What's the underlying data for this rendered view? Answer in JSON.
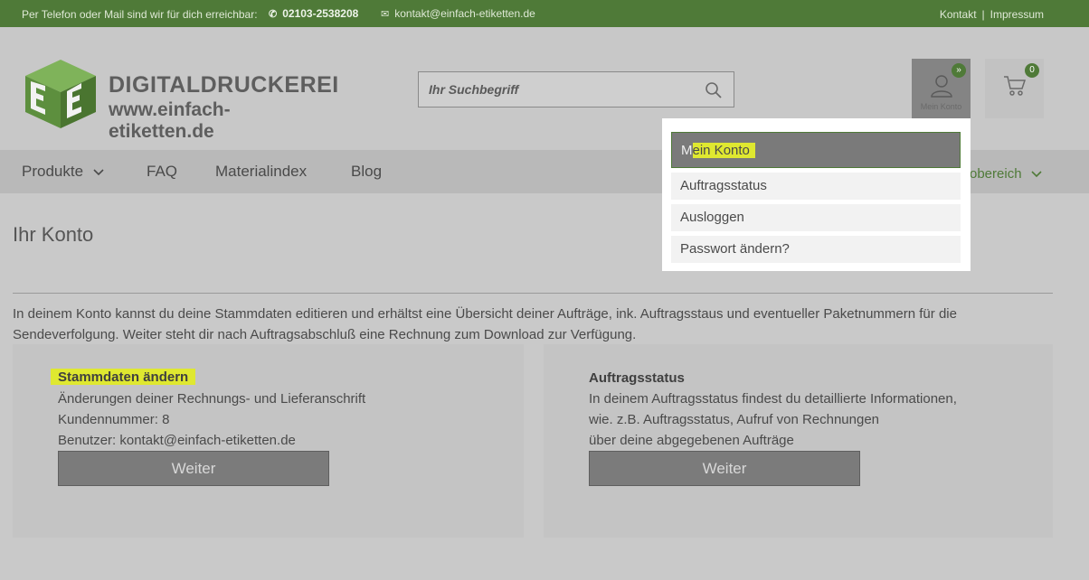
{
  "topbar": {
    "contact_text": "Per Telefon oder Mail sind wir für dich erreichbar:",
    "phone": "02103-2538208",
    "email": "kontakt@einfach-etiketten.de",
    "links": [
      "Kontakt",
      "Impressum"
    ],
    "separator": "|"
  },
  "header": {
    "logo_line1": "DIGITALDRUCKEREI",
    "logo_line2": "www.einfach-etiketten.de",
    "search_placeholder": "Ihr Suchbegriff",
    "account_label": "Mein Konto",
    "account_badge": "»",
    "cart_count": "0"
  },
  "nav": {
    "items": [
      "Produkte",
      "FAQ",
      "Materialindex",
      "Blog"
    ],
    "right_item": "obereich"
  },
  "main": {
    "title": "Ihr Konto",
    "intro": "In deinem Konto kannst du deine Stammdaten editieren und erhältst eine Übersicht deiner Aufträge, ink. Auftragsstaus und eventueller Paketnummern für die Sendeverfolgung. Weiter steht dir nach Auftragsabschluß eine Rechnung zum Download zur Verfügung.",
    "panels": [
      {
        "title": "Stammdaten ändern",
        "lines": [
          "Änderungen deiner Rechnungs- und Lieferanschrift",
          "Kundennummer: 8",
          "Benutzer: kontakt@einfach-etiketten.de"
        ],
        "button": "Weiter"
      },
      {
        "title": "Auftragsstatus",
        "lines": [
          "In deinem Auftragsstatus findest du detaillierte Informationen,",
          "wie. z.B. Auftragsstatus, Aufruf von Rechnungen",
          "über deine abgegebenen Aufträge"
        ],
        "button": "Weiter"
      }
    ]
  },
  "dropdown": {
    "active_first": "M",
    "active_rest": "ein Konto",
    "items": [
      "Auftragsstatus",
      "Ausloggen",
      "Passwort ändern?"
    ]
  },
  "colors": {
    "brand_green": "#4f7a38",
    "highlight_yellow": "#dfe830"
  }
}
